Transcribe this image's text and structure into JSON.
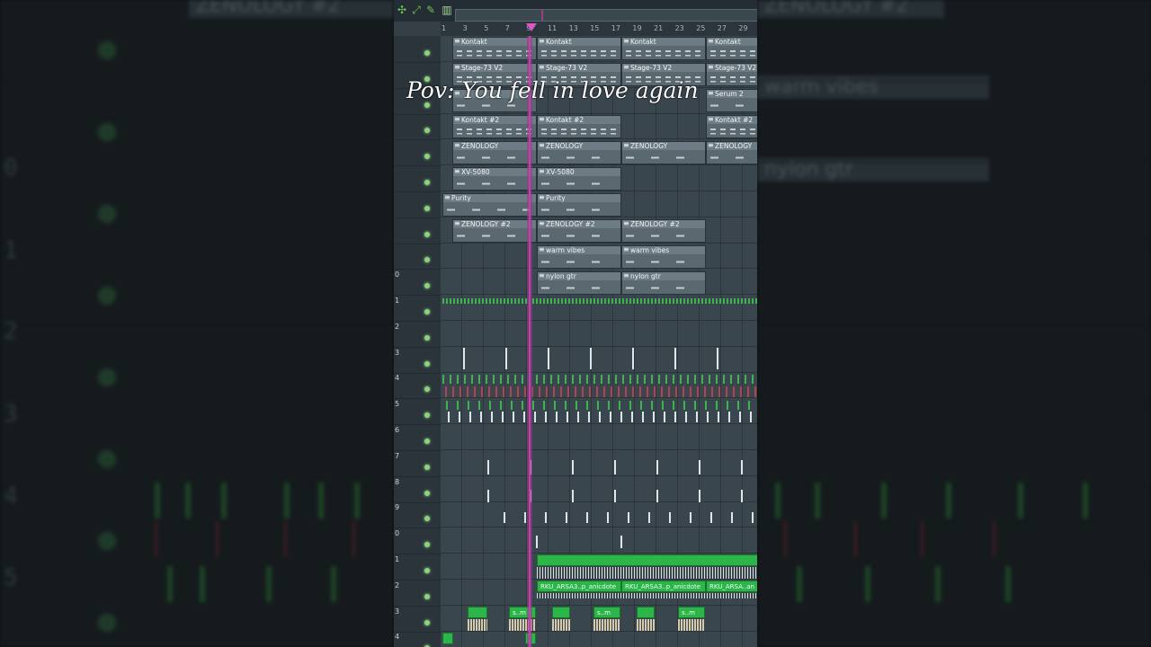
{
  "caption": "Pov: You fell in love again",
  "colors": {
    "accent_green": "#2db54a",
    "playhead": "#b44aa6",
    "clip_gray": "#5a6870"
  },
  "toolbar": {
    "icons": [
      "snap-icon",
      "tools-icon",
      "pencil-icon",
      "bars-icon"
    ]
  },
  "ruler": {
    "ticks": [
      "1",
      "3",
      "5",
      "7",
      "9",
      "11",
      "13",
      "15",
      "17",
      "19",
      "21",
      "23",
      "25",
      "27",
      "29"
    ]
  },
  "tracks": {
    "numbers": [
      "",
      "",
      "",
      "",
      "",
      "",
      "",
      "",
      "",
      "0",
      "1",
      "2",
      "3",
      "4",
      "5",
      "6",
      "7",
      "8",
      "9",
      "0",
      "1",
      "2",
      "3",
      "4"
    ]
  },
  "clips": {
    "kontakt": "Kontakt",
    "stage73": "Stage-73 V2",
    "serum": "Serum 2",
    "kontakt2": "Kontakt #2",
    "zenology": "ZENOLOGY",
    "xv5080": "XV-5080",
    "purity": "Purity",
    "zenology2": "ZENOLOGY #2",
    "warm": "warm vibes",
    "nylon": "nylon gtr",
    "audio": "RKU_ARSA3..p_anicdote",
    "audio_tail": "RKU_ARSA..an",
    "short": "s..m"
  },
  "backdrop": {
    "left_numbers": [
      "0",
      "1",
      "2",
      "3",
      "4",
      "5"
    ],
    "right_labels": [
      "ZENOLOGY #2",
      "warm vibes",
      "nylon gtr"
    ],
    "left_label": "ZENOLOGY #2"
  }
}
